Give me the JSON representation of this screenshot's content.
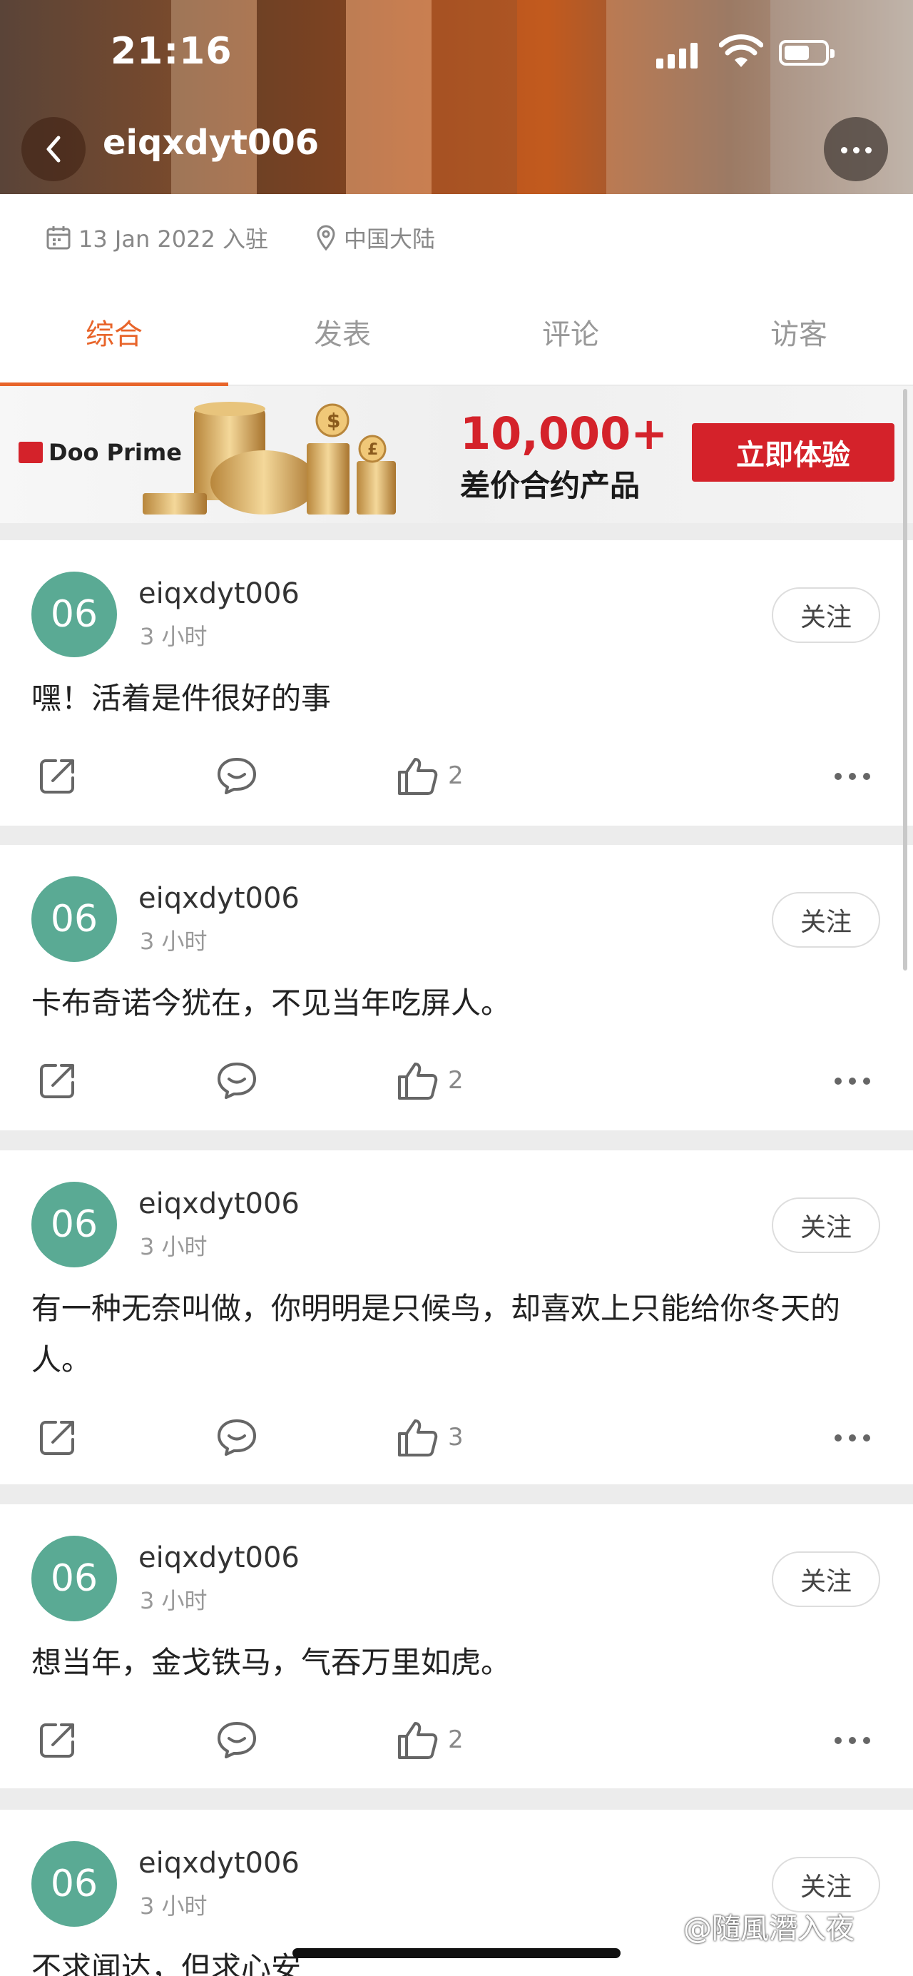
{
  "status_bar": {
    "time": "21:16"
  },
  "nav": {
    "title": "eiqxdyt006"
  },
  "meta": {
    "joined": "13 Jan 2022 入驻",
    "location": "中国大陆"
  },
  "tabs": [
    {
      "label": "综合"
    },
    {
      "label": "发表"
    },
    {
      "label": "评论"
    },
    {
      "label": "访客"
    }
  ],
  "banner": {
    "brand": "Doo Prime",
    "headline": "10,000+",
    "subline": "差价合约产品",
    "button": "立即体验"
  },
  "posts": [
    {
      "avatar": "06",
      "name": "eiqxdyt006",
      "time": "3 小时",
      "follow": "关注",
      "content": "嘿！活着是件很好的事",
      "likes": "2"
    },
    {
      "avatar": "06",
      "name": "eiqxdyt006",
      "time": "3 小时",
      "follow": "关注",
      "content": "卡布奇诺今犹在，不见当年吃屏人。",
      "likes": "2"
    },
    {
      "avatar": "06",
      "name": "eiqxdyt006",
      "time": "3 小时",
      "follow": "关注",
      "content": "有一种无奈叫做，你明明是只候鸟，却喜欢上只能给你冬天的人。",
      "likes": "3"
    },
    {
      "avatar": "06",
      "name": "eiqxdyt006",
      "time": "3 小时",
      "follow": "关注",
      "content": "想当年，金戈铁马，气吞万里如虎。",
      "likes": "2"
    },
    {
      "avatar": "06",
      "name": "eiqxdyt006",
      "time": "3 小时",
      "follow": "关注",
      "content": "不求闻达，但求心安",
      "likes": ""
    }
  ],
  "watermark": "@隨風潛入夜",
  "colors": {
    "accent": "#e8652b",
    "avatar_bg": "#5aaa94",
    "promo_red": "#d4222a"
  }
}
